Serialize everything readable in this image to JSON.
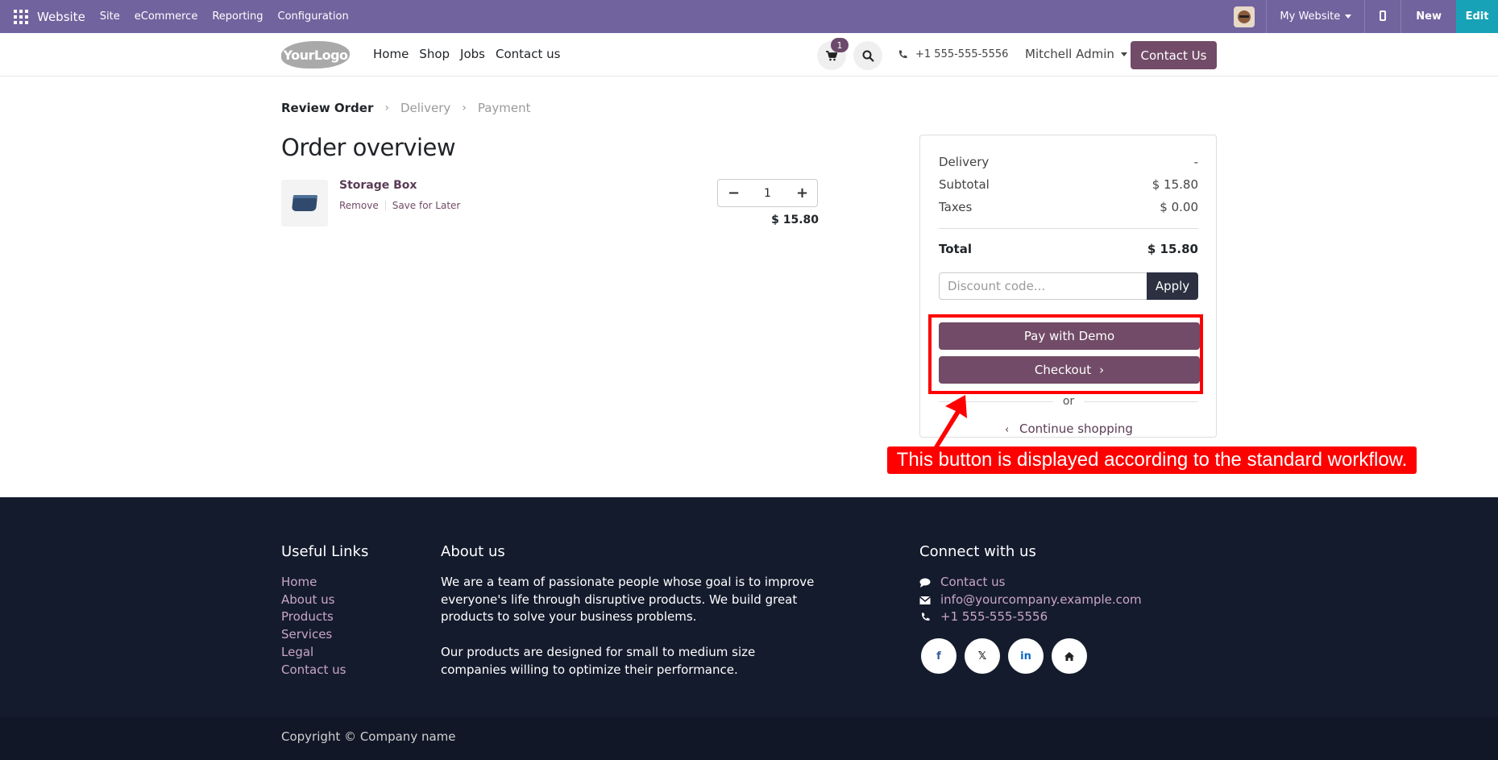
{
  "admin_bar": {
    "brand": "Website",
    "menu": [
      "Site",
      "eCommerce",
      "Reporting",
      "Configuration"
    ],
    "website_selector": "My Website",
    "new_label": "New",
    "edit_label": "Edit"
  },
  "header": {
    "logo_text": "YourLogo",
    "nav": [
      "Home",
      "Shop",
      "Jobs",
      "Contact us"
    ],
    "cart_count": "1",
    "phone": "+1 555-555-5556",
    "user": "Mitchell Admin",
    "contact_button": "Contact Us"
  },
  "steps": {
    "items": [
      "Review Order",
      "Delivery",
      "Payment"
    ],
    "active": "Review Order"
  },
  "page_title": "Order overview",
  "cart_line": {
    "name": "Storage Box",
    "remove_label": "Remove",
    "save_label": "Save for Later",
    "quantity": "1",
    "price": "$ 15.80"
  },
  "summary": {
    "delivery_label": "Delivery",
    "delivery_value": "-",
    "subtotal_label": "Subtotal",
    "subtotal_value": "$ 15.80",
    "taxes_label": "Taxes",
    "taxes_value": "$ 0.00",
    "total_label": "Total",
    "total_value": "$ 15.80",
    "discount_placeholder": "Discount code...",
    "apply_label": "Apply",
    "pay_label": "Pay with Demo",
    "checkout_label": "Checkout",
    "or_label": "or",
    "continue_label": "Continue shopping"
  },
  "annotation": {
    "text": "This button is displayed according to the standard workflow.",
    "color": "#ff0000"
  },
  "footer": {
    "links_title": "Useful Links",
    "links": [
      "Home",
      "About us",
      "Products",
      "Services",
      "Legal",
      "Contact us"
    ],
    "about_title": "About us",
    "about_p1": "We are a team of passionate people whose goal is to improve everyone's life through disruptive products. We build great products to solve your business problems.",
    "about_p2": "Our products are designed for small to medium size companies willing to optimize their performance.",
    "connect_title": "Connect with us",
    "contact_link": "Contact us",
    "email": "info@yourcompany.example.com",
    "phone": "+1 555-555-5556",
    "socials": [
      "facebook-icon",
      "x-icon",
      "linkedin-icon",
      "home-icon"
    ],
    "copyright": "Copyright © Company name"
  },
  "colors": {
    "admin_bar": "#71639e",
    "primary": "#714b67",
    "edit": "#17a2b8",
    "footer": "#141b2d"
  }
}
